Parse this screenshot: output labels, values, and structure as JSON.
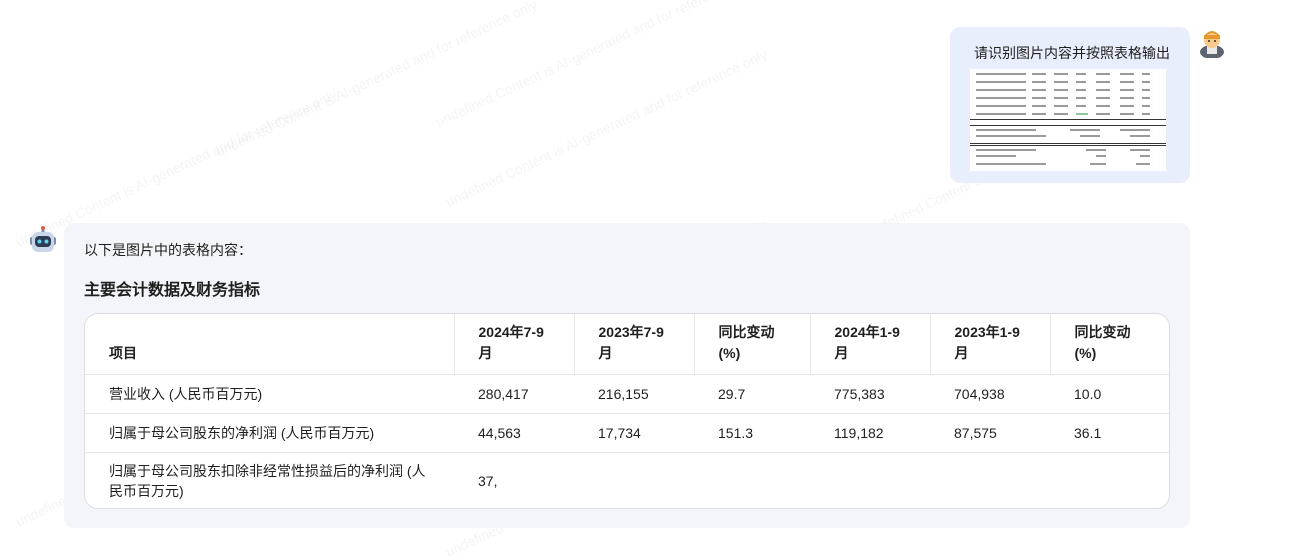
{
  "user_message": {
    "text": "请识别图片内容并按照表格输出"
  },
  "assistant_message": {
    "intro": "以下是图片中的表格内容：",
    "heading": "主要会计数据及财务指标",
    "table": {
      "headers": [
        "项目",
        "2024年7-9月",
        "2023年7-9月",
        "同比变动 (%)",
        "2024年1-9月",
        "2023年1-9月",
        "同比变动 (%)"
      ],
      "rows": [
        [
          "营业收入 (人民币百万元)",
          "280,417",
          "216,155",
          "29.7",
          "775,383",
          "704,938",
          "10.0"
        ],
        [
          "归属于母公司股东的净利润 (人民币百万元)",
          "44,563",
          "17,734",
          "151.3",
          "119,182",
          "87,575",
          "36.1"
        ],
        [
          "归属于母公司股东扣除非经常性损益后的净利润 (人民币百万元)",
          "37,",
          "",
          "",
          "",
          "",
          ""
        ]
      ]
    }
  },
  "watermark": "undefined Content is AI-generated and for reference only",
  "icons": {
    "user_avatar": "user-avatar-icon",
    "bot_avatar": "robot-avatar-icon"
  }
}
